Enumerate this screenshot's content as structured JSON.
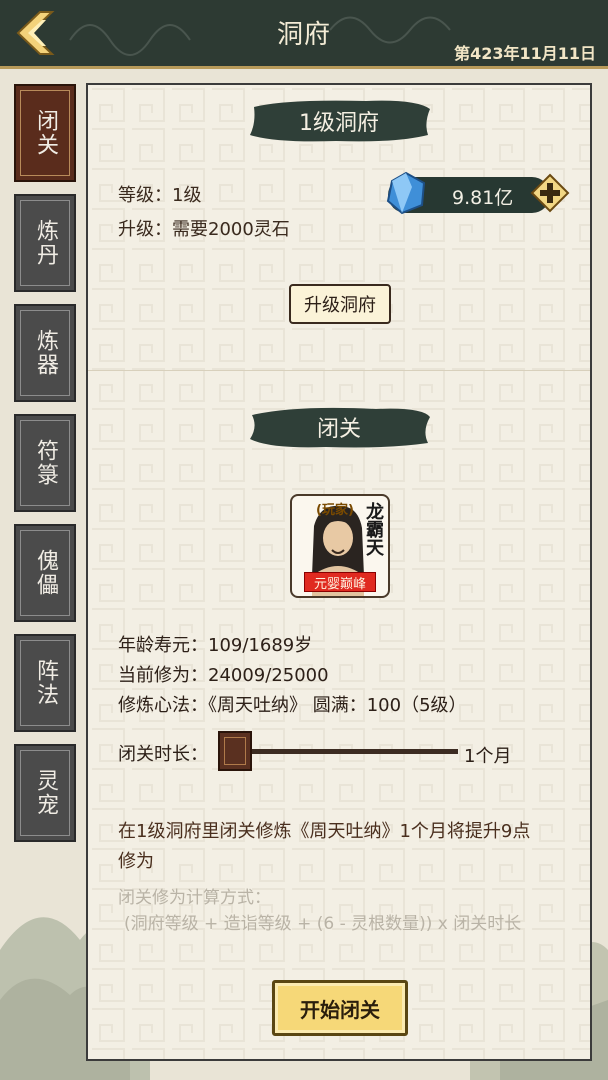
{
  "header": {
    "title": "洞府",
    "date": "第423年11月11日"
  },
  "sidebar": {
    "tabs": [
      {
        "label": "闭关",
        "active": true
      },
      {
        "label": "炼丹",
        "active": false
      },
      {
        "label": "炼器",
        "active": false
      },
      {
        "label": "符箓",
        "active": false
      },
      {
        "label": "傀儡",
        "active": false
      },
      {
        "label": "阵法",
        "active": false
      },
      {
        "label": "灵宠",
        "active": false
      }
    ]
  },
  "cave": {
    "banner": "1级洞府",
    "level_line": "等级：1级",
    "upgrade_line": "升级：需要2000灵石",
    "spirit_stones": "9.81亿",
    "upgrade_button": "升级洞府"
  },
  "retreat": {
    "banner": "闭关",
    "player_tag": "(玩家)",
    "player_name": "龙霸天",
    "realm": "元婴巅峰",
    "age_line": "年龄寿元：109/1689岁",
    "cultivation_line": "当前修为：24009/25000",
    "method_line": "修炼心法：《周天吐纳》 圆满：100（5级）",
    "duration_label": "闭关时长：",
    "duration_value": "1个月",
    "duration_fraction": 0.0,
    "description": "在1级洞府里闭关修炼《周天吐纳》1个月将提升9点修为",
    "formula_title": "闭关修为计算方式：",
    "formula": "(洞府等级 + 造诣等级 + (6 - 灵根数量)) x 闭关时长",
    "start_button": "开始闭关"
  },
  "colors": {
    "header_bg": "#2d3a33",
    "active_tab": "#5a2c1c",
    "inactive_tab": "#4b4b4b",
    "banner_ink": "#2f3f38",
    "realm_red": "#e02a20",
    "start_gold": "#f6d878"
  }
}
